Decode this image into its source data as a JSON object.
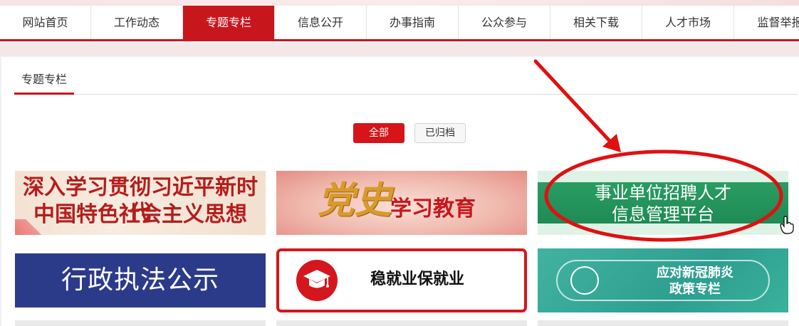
{
  "nav": {
    "items": [
      "网站首页",
      "工作动态",
      "专题专栏",
      "信息公开",
      "办事指南",
      "公众参与",
      "相关下载",
      "人才市场",
      "监督举报"
    ],
    "active_index": 2
  },
  "section": {
    "title": "专题专栏"
  },
  "filters": {
    "all": "全部",
    "archived": "已归档",
    "active": "all"
  },
  "cards": [
    {
      "line1": "深入学习贯彻习近平新时代",
      "line2": "中国特色社会主义思想"
    },
    {
      "big": "党史",
      "rest": "学习教育"
    },
    {
      "line1": "事业单位招聘人才",
      "line2": "信息管理平台"
    },
    {
      "text": "行政执法公示"
    },
    {
      "text": "稳就业保就业",
      "icon": "graduation-cap-icon"
    },
    {
      "line1": "应对新冠肺炎",
      "line2": "政策专栏",
      "icon": "lungs-icon"
    }
  ],
  "colors": {
    "brand_red": "#c8161d",
    "annotation_red": "#e01010"
  }
}
